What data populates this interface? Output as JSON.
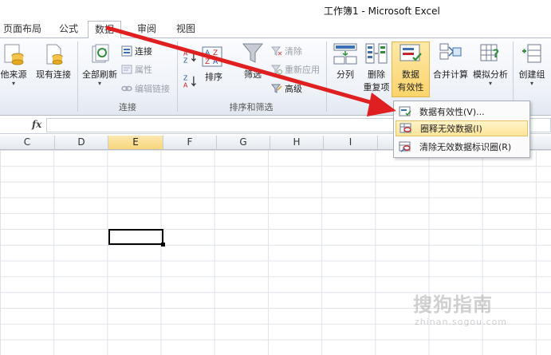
{
  "window": {
    "title": "工作簿1 - Microsoft Excel"
  },
  "tabs": [
    {
      "label": "页面布局",
      "active": false
    },
    {
      "label": "公式",
      "active": false
    },
    {
      "label": "数据",
      "active": true
    },
    {
      "label": "审阅",
      "active": false
    },
    {
      "label": "视图",
      "active": false
    }
  ],
  "ribbon": {
    "get_external": {
      "other_sources": "他来源",
      "existing_connections": "现有连接"
    },
    "connections": {
      "refresh_all": "全部刷新",
      "connections": "连接",
      "properties": "属性",
      "edit_links": "编辑链接",
      "group_label": "连接"
    },
    "sort_filter": {
      "sort_az": "A↓Z",
      "sort_za": "Z↓A",
      "sort": "排序",
      "filter": "筛选",
      "clear": "清除",
      "reapply": "重新应用",
      "advanced": "高级",
      "group_label": "排序和筛选"
    },
    "data_tools": {
      "text_to_columns": "分列",
      "remove_duplicates_1": "删除",
      "remove_duplicates_2": "重复项",
      "data_validation_1": "数据",
      "data_validation_2": "有效性",
      "consolidate": "合并计算",
      "what_if": "模拟分析"
    },
    "outline": {
      "group": "创建组"
    }
  },
  "formula_bar": {
    "fx": "fx",
    "value": ""
  },
  "columns": [
    "C",
    "D",
    "E",
    "F",
    "G",
    "H",
    "I"
  ],
  "selected_column": "E",
  "dropdown_menu": {
    "items": [
      {
        "label": "数据有效性(V)...",
        "icon": "data-validation-icon",
        "highlighted": false
      },
      {
        "label": "圈释无效数据(I)",
        "icon": "circle-invalid-icon",
        "highlighted": true
      },
      {
        "label": "清除无效数据标识圈(R)",
        "icon": "clear-circles-icon",
        "highlighted": false
      }
    ]
  },
  "watermark": {
    "main": "搜狗指南",
    "sub": "zhinan.sogou.com"
  },
  "colors": {
    "accent_highlight": "#fcd46b",
    "arrow": "#e02020",
    "selected_header": "#f8d57a"
  }
}
